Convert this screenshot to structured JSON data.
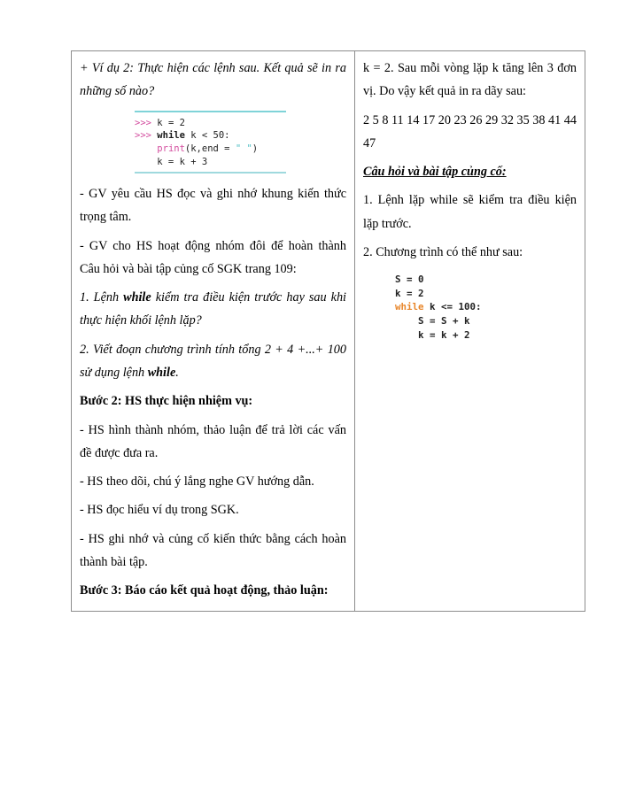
{
  "document": {
    "type": "lesson-plan-table",
    "border_color": "#8d8d8d",
    "background": "#ffffff"
  },
  "left_column": {
    "example_heading": {
      "prefix": "+ Ví dụ 2:",
      "text": "Thực hiện các lệnh sau. Kết quả sẽ in ra những số nào?"
    },
    "code_block_1": {
      "rule_color": "#7fd3d8",
      "lines": [
        [
          {
            "t": ">>> ",
            "c": "prompt"
          },
          {
            "t": "k = 2",
            "c": "plain"
          }
        ],
        [
          {
            "t": ">>> ",
            "c": "prompt"
          },
          {
            "t": "while",
            "c": "kw"
          },
          {
            "t": " k < 50:",
            "c": "plain"
          }
        ],
        [
          {
            "t": "    ",
            "c": "plain"
          },
          {
            "t": "print",
            "c": "fn"
          },
          {
            "t": "(k,end = ",
            "c": "plain"
          },
          {
            "t": "\" \"",
            "c": "str"
          },
          {
            "t": ")",
            "c": "plain"
          }
        ],
        [
          {
            "t": "    k = k + 3",
            "c": "plain"
          }
        ]
      ]
    },
    "paragraphs": [
      "- GV yêu cầu HS đọc và ghi nhớ khung kiến thức trọng tâm.",
      "- GV cho HS hoạt động nhóm đôi để hoàn thành Câu hỏi và bài tập củng cố SGK trang 109:"
    ],
    "question_1": {
      "before": "1. Lệnh ",
      "keyword": "while",
      "after": " kiểm tra điều kiện trước hay sau khi thực hiện khối lệnh lặp?"
    },
    "question_2": {
      "before": "2. Viết đoạn chương trình tính tổng 2 + 4 +...+ 100 sử dụng lệnh ",
      "keyword": "while",
      "after": "."
    },
    "step2_heading": "Bước 2: HS thực hiện nhiệm vụ:",
    "step2_items": [
      "- HS hình thành nhóm, thảo luận để trả lời các vấn đề được đưa ra.",
      "- HS theo dõi, chú ý lắng nghe GV hướng dẫn.",
      "- HS đọc hiểu ví dụ trong SGK.",
      "- HS ghi nhớ và củng cố kiến thức bằng cách hoàn thành bài tập."
    ],
    "step3_heading": "Bước 3: Báo cáo kết quả hoạt động, thảo luận:"
  },
  "right_column": {
    "answer_paragraphs": [
      "k = 2. Sau mỗi vòng lặp k tăng lên 3 đơn vị. Do vậy kết quả in ra dãy sau:",
      "2 5 8 11 14 17 20 23 26 29 32 35 38 41 44 47"
    ],
    "exercise_heading": "Câu hỏi và bài tập củng cố:",
    "answer_1": "1. Lệnh lặp while sẽ kiểm tra điều kiện lặp trước.",
    "answer_2": "2. Chương trình có thể như sau:",
    "code_block_2": {
      "keyword_color": "#e8862a",
      "lines": [
        [
          {
            "t": "S = 0",
            "c": "plain"
          }
        ],
        [
          {
            "t": "k = 2",
            "c": "plain"
          }
        ],
        [
          {
            "t": "while",
            "c": "kw-org"
          },
          {
            "t": " k <= 100:",
            "c": "plain"
          }
        ],
        [
          {
            "t": "    S = S + k",
            "c": "plain"
          }
        ],
        [
          {
            "t": "    k = k + 2",
            "c": "plain"
          }
        ]
      ]
    }
  }
}
